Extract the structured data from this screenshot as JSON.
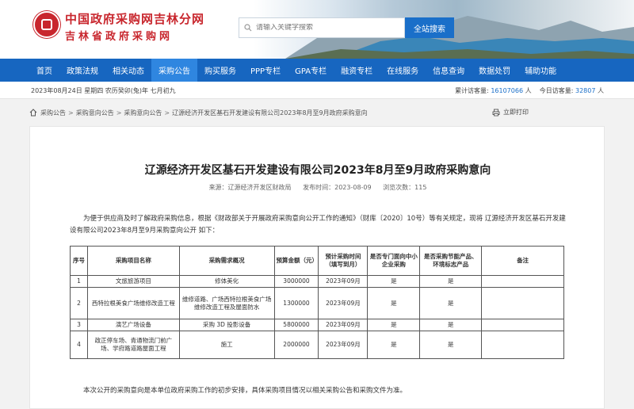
{
  "header": {
    "site_title": "中国政府采购网吉林分网",
    "site_subtitle": "吉林省政府采购网",
    "search": {
      "placeholder": "请输入关键字搜索",
      "button": "全站搜索"
    }
  },
  "nav": [
    "首页",
    "政策法规",
    "相关动态",
    "采购公告",
    "购买服务",
    "PPP专栏",
    "GPA专栏",
    "融资专栏",
    "在线服务",
    "信息查询",
    "数据处罚",
    "辅助功能"
  ],
  "nav_active_index": 3,
  "infobar": {
    "date": "2023年08月24日 星期四 农历癸卯(兔)年 七月初九",
    "total_label": "累计访客量:",
    "total_value": "16107066",
    "total_unit": "人",
    "today_label": "今日访客量:",
    "today_value": "32807",
    "today_unit": "人"
  },
  "breadcrumb": [
    "采购公告",
    "采购意向公告",
    "采购意向公告",
    "辽源经济开发区基石开发建设有限公司2023年8月至9月政府采购意向"
  ],
  "print_label": "立即打印",
  "article": {
    "title": "辽源经济开发区基石开发建设有限公司2023年8月至9月政府采购意向",
    "source": "来源：辽源经济开发区财政局",
    "publish_time": "发布时间：2023-08-09",
    "views": "浏览次数：115",
    "intro": "为便于供应商及时了解政府采购信息，根据《财政部关于开展政府采购意向公开工作的通知》（财库〔2020〕10号）等有关规定，现将      辽源经济开发区基石开发建设有限公司2023年8月至9月采购意向公开 如下：",
    "footer_note": "本次公开的采购意向是本单位政府采购工作的初步安排，具体采购项目情况以相关采购公告和采购文件为准。"
  },
  "table": {
    "headers": [
      "序号",
      "采购项目名称",
      "采购需求概况",
      "预算金额（元）",
      "预计采购时间（填写到月）",
      "是否专门面向中小企业采购",
      "是否采购节能产品、环境标志产品",
      "备注"
    ],
    "rows": [
      [
        "1",
        "文旅旅游项目",
        "修体美化",
        "3000000",
        "2023年09月",
        "是",
        "是",
        ""
      ],
      [
        "2",
        "西特拉根美食广场维修改造工程",
        "维修道路、广场西特拉根美食广场维修改造工程及屋面防水",
        "1300000",
        "2023年09月",
        "是",
        "是",
        ""
      ],
      [
        "3",
        "演艺广场设备",
        "采购 3D 投影设备",
        "5800000",
        "2023年09月",
        "是",
        "是",
        ""
      ],
      [
        "4",
        "政正停车场、青通物流门前广场、学府路道路屋面工程",
        "施工",
        "2000000",
        "2023年09月",
        "是",
        "是",
        ""
      ]
    ]
  },
  "icons": {
    "logo": "emblem-logo",
    "search": "search-icon",
    "home": "home-icon",
    "print": "printer-icon"
  },
  "colors": {
    "brand_red": "#c8262d",
    "nav_blue": "#1766c0",
    "nav_active": "#2f86e0",
    "link_blue": "#1a6fc9"
  }
}
